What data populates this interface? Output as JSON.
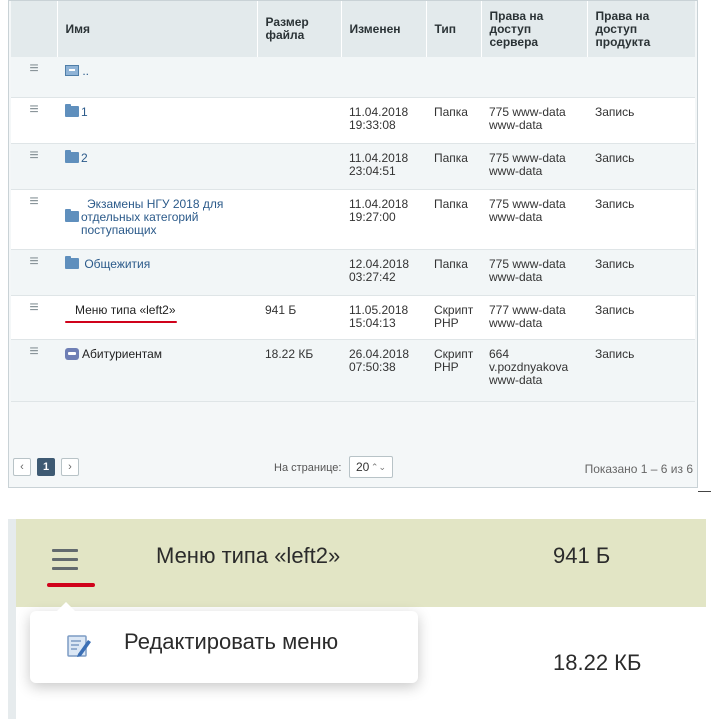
{
  "table": {
    "headers": {
      "name": "Имя",
      "size": "Размер файла",
      "modified": "Изменен",
      "type": "Тип",
      "server_rights": "Права на доступ сервера",
      "product_rights": "Права на доступ продукта"
    },
    "rows": [
      {
        "name": "..",
        "size": "",
        "date": "",
        "time": "",
        "type": "",
        "rights1": "",
        "rights2": "",
        "rights3": "",
        "product": ""
      },
      {
        "name": "1",
        "size": "",
        "date": "11.04.2018",
        "time": "19:33:08",
        "type": "Папка",
        "rights1": "775 www-data",
        "rights2": "www-data",
        "rights3": "",
        "product": "Запись"
      },
      {
        "name": "2",
        "size": "",
        "date": "11.04.2018",
        "time": "23:04:51",
        "type": "Папка",
        "rights1": "775 www-data",
        "rights2": "www-data",
        "rights3": "",
        "product": "Запись"
      },
      {
        "name_line1": "Экзамены НГУ 2018 для",
        "name_line2": "отдельных категорий",
        "name_line3": "поступающих",
        "size": "",
        "date": "11.04.2018",
        "time": "19:27:00",
        "type": "Папка",
        "rights1": "775 www-data",
        "rights2": "www-data",
        "rights3": "",
        "product": "Запись"
      },
      {
        "name": "Общежития",
        "size": "",
        "date": "12.04.2018",
        "time": "03:27:42",
        "type": "Папка",
        "rights1": "775 www-data",
        "rights2": "www-data",
        "rights3": "",
        "product": "Запись"
      },
      {
        "name": "Меню типа «left2»",
        "size": "941 Б",
        "date": "11.05.2018",
        "time": "15:04:13",
        "type_line1": "Скрипт",
        "type_line2": "PHP",
        "rights1": "777 www-data",
        "rights2": "www-data",
        "rights3": "",
        "product": "Запись"
      },
      {
        "name": "Абитуриентам",
        "size": "18.22 КБ",
        "date": "26.04.2018",
        "time": "07:50:38",
        "type_line1": "Скрипт",
        "type_line2": "PHP",
        "rights1": "664",
        "rights2": "v.pozdnyakova",
        "rights3": "www-data",
        "product": "Запись"
      }
    ]
  },
  "pager": {
    "prev": "‹",
    "current": "1",
    "next": "›",
    "per_page_label": "На странице:",
    "per_page_value": "20",
    "per_page_arrow": "⌃⌄",
    "shown": "Показано 1 – 6 из 6"
  },
  "zoom": {
    "row_name": "Меню типа «left2»",
    "row_size": "941 Б",
    "next_row_size": "18.22 КБ",
    "menu_item": "Редактировать меню"
  },
  "colors": {
    "accent_red": "#d0021b",
    "highlight_row": "#e2e5c5",
    "link_blue": "#2b5a8a",
    "folder_blue": "#5f8fbd",
    "pager_active": "#3e5a73"
  }
}
